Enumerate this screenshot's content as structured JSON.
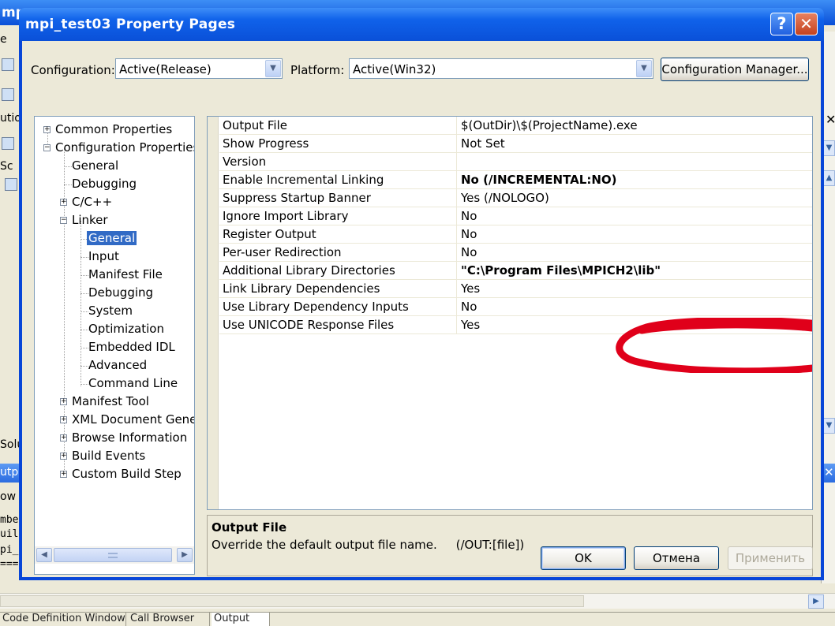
{
  "background": {
    "title_fragment": "mp",
    "left_fragments": [
      "e",
      "utio",
      "Sc",
      "Solu",
      "utpu",
      "ow o"
    ],
    "left_code_fragments": [
      "mbe",
      "uil",
      "pi_",
      "==="
    ],
    "bottom_tabs": [
      "Code Definition Window",
      "Call Browser",
      "Output"
    ]
  },
  "dialog": {
    "title": "mpi_test03 Property Pages",
    "help_glyph": "?",
    "close_glyph": "✕",
    "configuration_label": "Configuration:",
    "configuration_value": "Active(Release)",
    "platform_label": "Platform:",
    "platform_value": "Active(Win32)",
    "config_manager_label": "Configuration Manager...",
    "ok_label": "OK",
    "cancel_label": "Отмена",
    "apply_label": "Применить"
  },
  "tree": [
    {
      "label": "Common Properties",
      "expander": "+"
    },
    {
      "label": "Configuration Properties",
      "expander": "−"
    },
    {
      "label": "General"
    },
    {
      "label": "Debugging"
    },
    {
      "label": "C/C++",
      "expander": "+"
    },
    {
      "label": "Linker",
      "expander": "−"
    },
    {
      "label": "General",
      "selected": true
    },
    {
      "label": "Input"
    },
    {
      "label": "Manifest File"
    },
    {
      "label": "Debugging"
    },
    {
      "label": "System"
    },
    {
      "label": "Optimization"
    },
    {
      "label": "Embedded IDL"
    },
    {
      "label": "Advanced"
    },
    {
      "label": "Command Line"
    },
    {
      "label": "Manifest Tool",
      "expander": "+"
    },
    {
      "label": "XML Document Genera",
      "expander": "+"
    },
    {
      "label": "Browse Information",
      "expander": "+"
    },
    {
      "label": "Build Events",
      "expander": "+"
    },
    {
      "label": "Custom Build Step",
      "expander": "+"
    }
  ],
  "properties": [
    {
      "name": "Output File",
      "value": "$(OutDir)\\$(ProjectName).exe"
    },
    {
      "name": "Show Progress",
      "value": "Not Set"
    },
    {
      "name": "Version",
      "value": ""
    },
    {
      "name": "Enable Incremental Linking",
      "value": "No (/INCREMENTAL:NO)",
      "bold": true
    },
    {
      "name": "Suppress Startup Banner",
      "value": "Yes (/NOLOGO)"
    },
    {
      "name": "Ignore Import Library",
      "value": "No"
    },
    {
      "name": "Register Output",
      "value": "No"
    },
    {
      "name": "Per-user Redirection",
      "value": "No"
    },
    {
      "name": "Additional Library Directories",
      "value": "\"C:\\Program Files\\MPICH2\\lib\"",
      "bold": true
    },
    {
      "name": "Link Library Dependencies",
      "value": "Yes"
    },
    {
      "name": "Use Library Dependency Inputs",
      "value": "No"
    },
    {
      "name": "Use UNICODE Response Files",
      "value": "Yes"
    }
  ],
  "description": {
    "title": "Output File",
    "text": "Override the default output file name.     (/OUT:[file])"
  },
  "colors": {
    "titlebar": "#0a50d8",
    "selection": "#316ac5",
    "annotation": "#e0001a"
  }
}
